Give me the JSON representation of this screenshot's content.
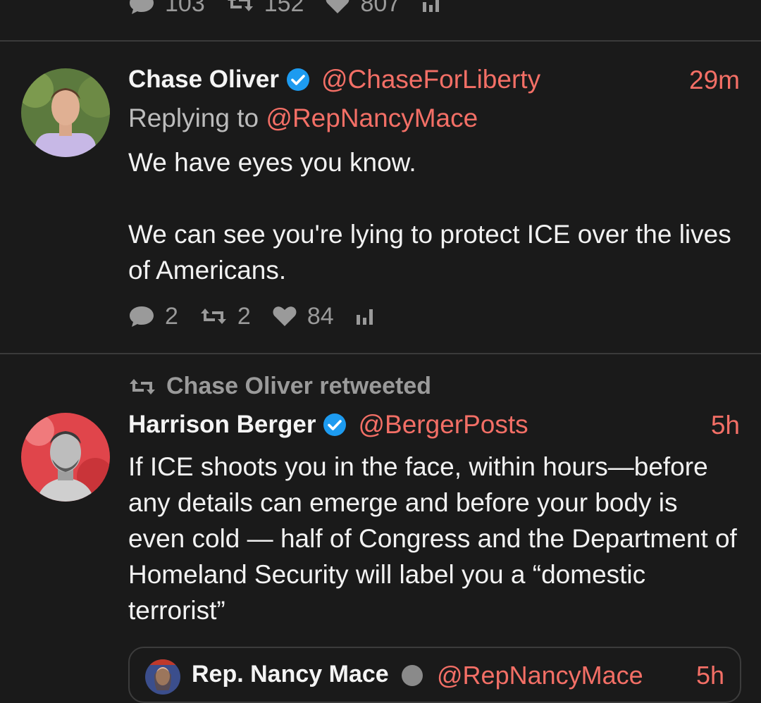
{
  "prev_tweet": {
    "stats": {
      "replies": "103",
      "retweets": "152",
      "likes": "807"
    }
  },
  "tweet1": {
    "name": "Chase Oliver",
    "handle": "@ChaseForLiberty",
    "time": "29m",
    "replying_prefix": "Replying to",
    "replying_to": "@RepNancyMace",
    "body": "We have eyes you know.\n\nWe can see you're lying to protect ICE over the lives of Americans.",
    "stats": {
      "replies": "2",
      "retweets": "2",
      "likes": "84"
    }
  },
  "tweet2": {
    "retweeted_by": "Chase Oliver retweeted",
    "name": "Harrison Berger",
    "handle": "@BergerPosts",
    "time": "5h",
    "body": "If ICE shoots you in the face, within hours—before any details can emerge and before your body is even cold — half of Congress and the Department of Homeland Security will label you a “domestic terrorist”",
    "quote": {
      "name": "Rep. Nancy Mace",
      "handle": "@RepNancyMace",
      "time": "5h"
    }
  },
  "colors": {
    "background": "#1a1a1a",
    "accent": "#f36f66",
    "verified": "#1d9bf0",
    "muted": "#9a9a9a",
    "divider": "#3a3a3a"
  },
  "icons": [
    "reply-icon",
    "retweet-icon",
    "like-icon",
    "analytics-icon",
    "verified-badge-icon"
  ]
}
